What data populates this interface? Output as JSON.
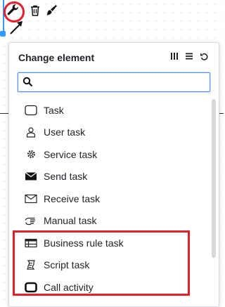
{
  "popup": {
    "title": "Change element",
    "search": {
      "value": "",
      "placeholder": ""
    },
    "header_icons": [
      "columns-icon",
      "list-icon",
      "reset-icon"
    ],
    "entries": [
      {
        "label": "Task",
        "icon": "task-icon"
      },
      {
        "label": "User task",
        "icon": "user-task-icon"
      },
      {
        "label": "Service task",
        "icon": "gear-icon"
      },
      {
        "label": "Send task",
        "icon": "envelope-filled-icon"
      },
      {
        "label": "Receive task",
        "icon": "envelope-outline-icon"
      },
      {
        "label": "Manual task",
        "icon": "hand-icon"
      },
      {
        "label": "Business rule task",
        "icon": "table-icon"
      },
      {
        "label": "Script task",
        "icon": "script-icon"
      },
      {
        "label": "Call activity",
        "icon": "call-activity-icon"
      }
    ]
  },
  "colors": {
    "accent": "#3399ff",
    "highlight": "#e2202a",
    "search_border": "#4d90fe"
  }
}
